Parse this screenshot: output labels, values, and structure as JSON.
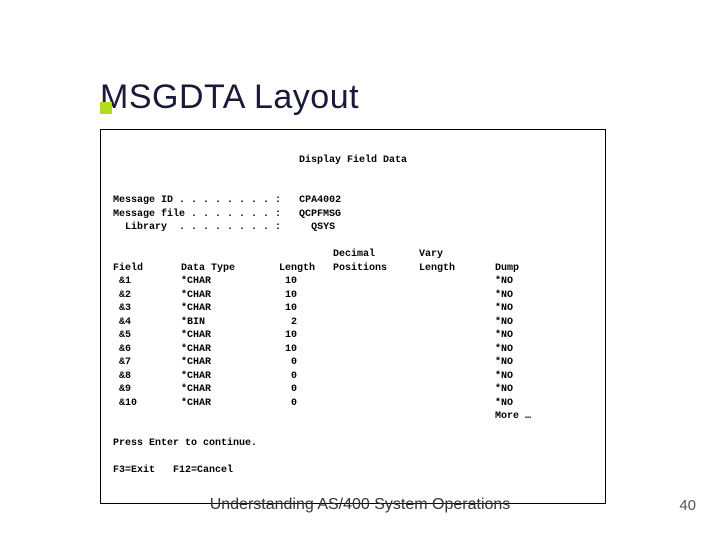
{
  "title": "MSGDTA Layout",
  "screen": {
    "heading": "Display Field Data",
    "header_rows": [
      {
        "label": "Message ID",
        "dots": " . . . . . . . . :",
        "value": "CPA4002"
      },
      {
        "label": "Message file",
        "dots": " . . . . . . . :",
        "value": "QCPFMSG"
      },
      {
        "label": "  Library ",
        "dots": " . . . . . . . . :",
        "value": "  QSYS"
      }
    ],
    "columns": {
      "c1": "Field",
      "c2": "Data Type",
      "c3": "Length",
      "c4a": "Decimal",
      "c4b": "Positions",
      "c5a": "Vary",
      "c5b": "Length",
      "c6": "Dump"
    },
    "rows": [
      {
        "field": "&1",
        "type": "*CHAR",
        "len": "10",
        "dec": "",
        "vary": "",
        "dump": "*NO"
      },
      {
        "field": "&2",
        "type": "*CHAR",
        "len": "10",
        "dec": "",
        "vary": "",
        "dump": "*NO"
      },
      {
        "field": "&3",
        "type": "*CHAR",
        "len": "10",
        "dec": "",
        "vary": "",
        "dump": "*NO"
      },
      {
        "field": "&4",
        "type": "*BIN",
        "len": "2",
        "dec": "",
        "vary": "",
        "dump": "*NO"
      },
      {
        "field": "&5",
        "type": "*CHAR",
        "len": "10",
        "dec": "",
        "vary": "",
        "dump": "*NO"
      },
      {
        "field": "&6",
        "type": "*CHAR",
        "len": "10",
        "dec": "",
        "vary": "",
        "dump": "*NO"
      },
      {
        "field": "&7",
        "type": "*CHAR",
        "len": "0",
        "dec": "",
        "vary": "",
        "dump": "*NO"
      },
      {
        "field": "&8",
        "type": "*CHAR",
        "len": "0",
        "dec": "",
        "vary": "",
        "dump": "*NO"
      },
      {
        "field": "&9",
        "type": "*CHAR",
        "len": "0",
        "dec": "",
        "vary": "",
        "dump": "*NO"
      },
      {
        "field": "&10",
        "type": "*CHAR",
        "len": "0",
        "dec": "",
        "vary": "",
        "dump": "*NO"
      }
    ],
    "more": "More …",
    "prompt": "Press Enter to continue.",
    "fkeys": "F3=Exit   F12=Cancel"
  },
  "footer": "Understanding AS/400 System Operations",
  "page_number": "40"
}
